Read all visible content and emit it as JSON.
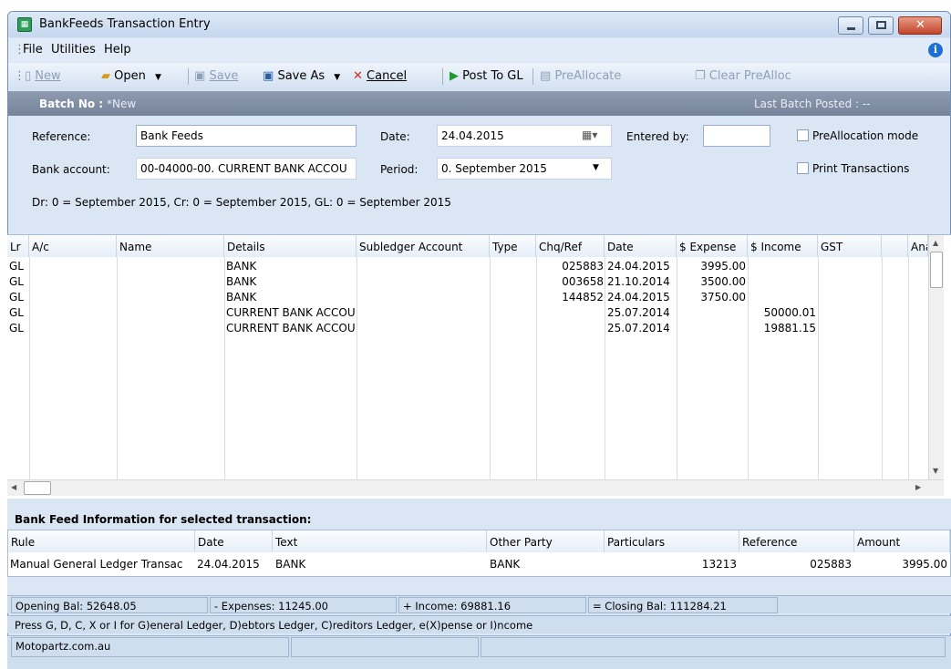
{
  "window": {
    "title": "BankFeeds Transaction Entry"
  },
  "menu": [
    "File",
    "Utilities",
    "Help"
  ],
  "toolbar": {
    "new": "New",
    "open": "Open",
    "save": "Save",
    "save_as": "Save As",
    "cancel": "Cancel",
    "post": "Post To GL",
    "preallocate": "PreAllocate",
    "clear_prealloc": "Clear PreAlloc"
  },
  "batch": {
    "label": "Batch No :",
    "value": "*New",
    "last_posted": "Last Batch Posted : --"
  },
  "form": {
    "reference_label": "Reference:",
    "reference_value": "Bank Feeds",
    "date_label": "Date:",
    "date_value": "24.04.2015",
    "entered_by_label": "Entered by:",
    "entered_by_value": "",
    "prealloc_mode": "PreAllocation mode",
    "bank_account_label": "Bank account:",
    "bank_account_value": "00-04000-00. CURRENT BANK ACCOU",
    "period_label": "Period:",
    "period_value": "0. September 2015",
    "print_transactions": "Print Transactions",
    "period_info": "Dr: 0 = September 2015,  Cr: 0 = September 2015,  GL: 0 = September 2015"
  },
  "grid": {
    "columns": [
      "Lr",
      "A/c",
      "Name",
      "Details",
      "Subledger Account",
      "Type",
      "Chq/Ref",
      "Date",
      "$ Expense",
      "$ Income",
      "GST",
      "Ana"
    ],
    "rows": [
      {
        "lr": "GL",
        "details": "BANK",
        "chq": "025883",
        "date": "24.04.2015",
        "expense": "3995.00",
        "income": ""
      },
      {
        "lr": "GL",
        "details": "BANK",
        "chq": "003658",
        "date": "21.10.2014",
        "expense": "3500.00",
        "income": ""
      },
      {
        "lr": "GL",
        "details": "BANK",
        "chq": "144852",
        "date": "24.04.2015",
        "expense": "3750.00",
        "income": ""
      },
      {
        "lr": "GL",
        "details": "CURRENT BANK ACCOU",
        "chq": "",
        "date": "25.07.2014",
        "expense": "",
        "income": "50000.01"
      },
      {
        "lr": "GL",
        "details": "CURRENT BANK ACCOU",
        "chq": "",
        "date": "25.07.2014",
        "expense": "",
        "income": "19881.15"
      }
    ]
  },
  "info": {
    "title": "Bank Feed Information for selected transaction:",
    "columns": [
      "Rule",
      "Date",
      "Text",
      "Other Party",
      "Particulars",
      "Reference",
      "Amount"
    ],
    "row": {
      "rule": "Manual General Ledger Transac",
      "date": "24.04.2015",
      "text": "BANK",
      "other_party": "BANK",
      "particulars": "13213",
      "reference": "025883",
      "amount": "3995.00"
    }
  },
  "status": {
    "opening": "Opening Bal: 52648.05",
    "expenses": "- Expenses: 11245.00",
    "income": "+ Income: 69881.16",
    "closing": "= Closing Bal: 111284.21",
    "hint": "Press G, D, C, X or I for G)eneral Ledger, D)ebtors Ledger, C)reditors Ledger, e(X)pense or I)ncome",
    "company": "Motopartz.com.au"
  }
}
